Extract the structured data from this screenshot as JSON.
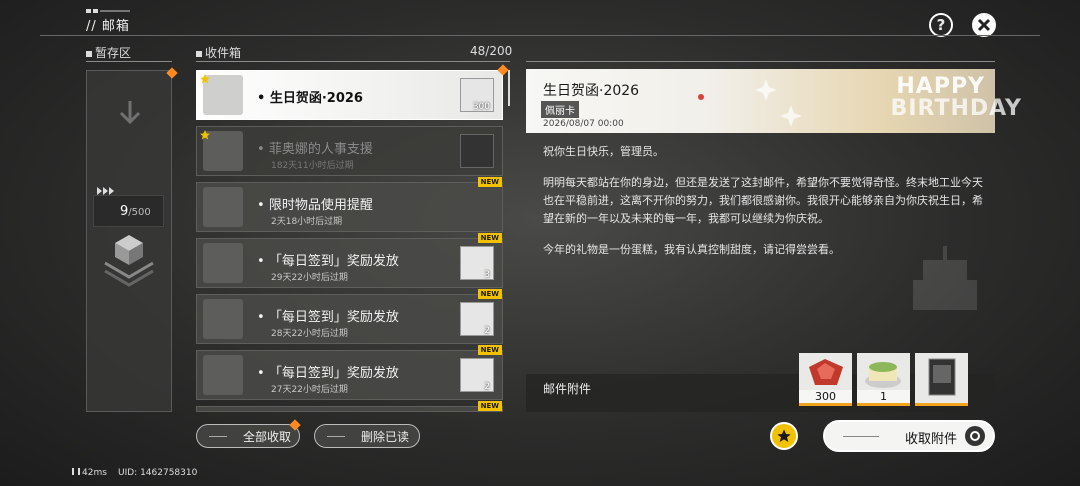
{
  "header": {
    "title": "// 邮箱"
  },
  "temp_storage": {
    "label": "暂存区",
    "count": "9",
    "capacity": "/500"
  },
  "inbox": {
    "label": "收件箱",
    "count": "48/200",
    "mails": [
      {
        "subject": "生日贺函·2026",
        "expire": "",
        "item_qty": "300",
        "new": false,
        "state": "selected",
        "starred": true
      },
      {
        "subject": "菲奥娜的人事支援",
        "expire": "182天11小时后过期",
        "item_qty": "",
        "new": false,
        "state": "read",
        "starred": true
      },
      {
        "subject": "限时物品使用提醒",
        "expire": "2天18小时后过期",
        "item_qty": "",
        "new": true,
        "state": "normal",
        "starred": false
      },
      {
        "subject": "「每日签到」奖励发放",
        "expire": "29天22小时后过期",
        "item_qty": "3",
        "new": true,
        "state": "normal",
        "starred": false
      },
      {
        "subject": "「每日签到」奖励发放",
        "expire": "28天22小时后过期",
        "item_qty": "2",
        "new": true,
        "state": "normal",
        "starred": false
      },
      {
        "subject": "「每日签到」奖励发放",
        "expire": "27天22小时后过期",
        "item_qty": "2",
        "new": true,
        "state": "normal",
        "starred": false
      }
    ],
    "new_label": "NEW",
    "collect_all": "全部收取",
    "delete_read": "删除已读"
  },
  "detail": {
    "title": "生日贺函·2026",
    "sender": "佩丽卡",
    "date": "2026/08/07 00:00",
    "banner_text_1": "HAPPY",
    "banner_text_2": "BIRTHDAY",
    "paragraphs": [
      "祝你生日快乐，管理员。",
      "明明每天都站在你的身边，但还是发送了这封邮件，希望你不要觉得奇怪。终末地工业今天也在平稳前进，这离不开你的努力，我们都很感谢你。我很开心能够亲自为你庆祝生日，希望在新的一年以及未来的每一年，我都可以继续为你庆祝。",
      "今年的礼物是一份蛋糕，我有认真控制甜度，请记得尝尝看。"
    ],
    "attachments_label": "邮件附件",
    "attachments": [
      {
        "qty": "300"
      },
      {
        "qty": "1"
      },
      {
        "qty": ""
      }
    ],
    "collect_attachments": "收取附件"
  },
  "footer": {
    "ping": "42ms",
    "uid": "UID: 1462758310"
  },
  "colors": {
    "accent": "#f2c200",
    "notify": "#ff8a1f"
  }
}
